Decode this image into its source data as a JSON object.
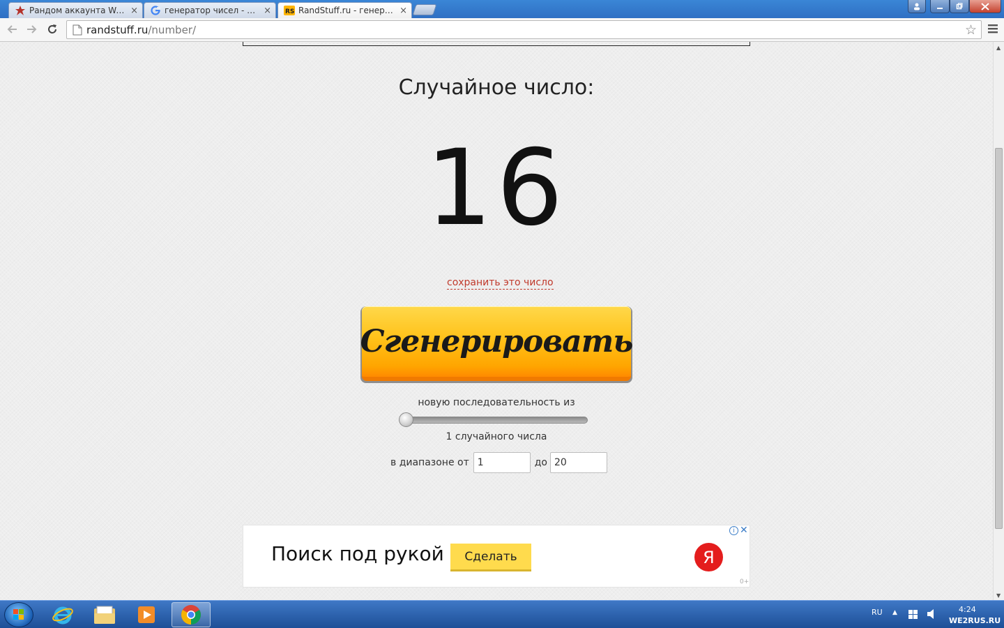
{
  "browser": {
    "tabs": [
      {
        "title": "Рандом аккаунта Warface",
        "favicon": "warface-star-icon",
        "close": "×"
      },
      {
        "title": "генератор чисел - Поиск",
        "favicon": "google-g-icon",
        "close": "×"
      },
      {
        "title": "RandStuff.ru - генератор с",
        "favicon": "randstuff-icon",
        "close": "×"
      }
    ],
    "url_host": "randstuff.ru",
    "url_path": "/number/",
    "star": "☆"
  },
  "page": {
    "heading": "Случайное число:",
    "number": "16",
    "save_link": "сохранить это число",
    "generate_button": "Сгенерировать",
    "sequence_label": "новую последовательность из",
    "count_label": "1 случайного числа",
    "slider_fraction": 0,
    "range_from_label": "в диапазоне от",
    "range_from_value": "1",
    "range_to_label": "до",
    "range_to_value": "20"
  },
  "ad": {
    "text": "Поиск под рукой",
    "button": "Сделать",
    "logo_letter": "Я",
    "info": "i",
    "close": "✕",
    "age": "0+"
  },
  "taskbar": {
    "lang": "RU",
    "tray_arrow": "▲",
    "clock": "4:24",
    "watermark": "WE2RUS.RU"
  },
  "colors": {
    "button_yellow": "#ffc21a",
    "button_orange": "#ff8a00",
    "link_red": "#c0392b",
    "yandex_red": "#e41d1d",
    "ad_button": "#ffdb4d"
  }
}
